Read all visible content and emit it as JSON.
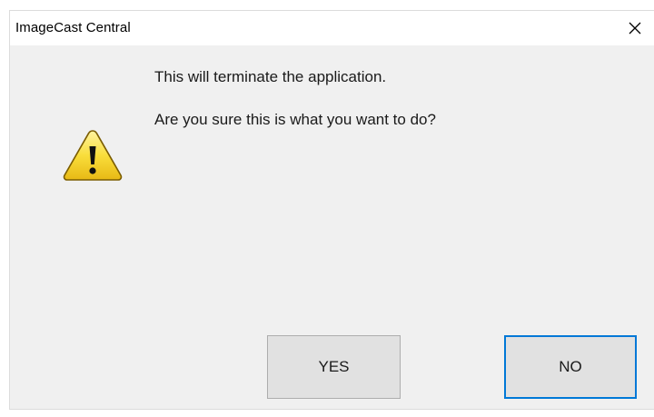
{
  "window": {
    "title": "ImageCast Central"
  },
  "dialog": {
    "icon": "warning-icon",
    "message_line_1": "This will terminate the application.",
    "message_line_2": "Are you sure this is what you want to do?"
  },
  "buttons": {
    "yes_label": "YES",
    "no_label": "NO"
  },
  "colors": {
    "dialog_background": "#f0f0f0",
    "titlebar_background": "#ffffff",
    "button_background": "#e1e1e1",
    "default_button_border": "#0078d7",
    "warning_fill": "#f9de3b"
  }
}
